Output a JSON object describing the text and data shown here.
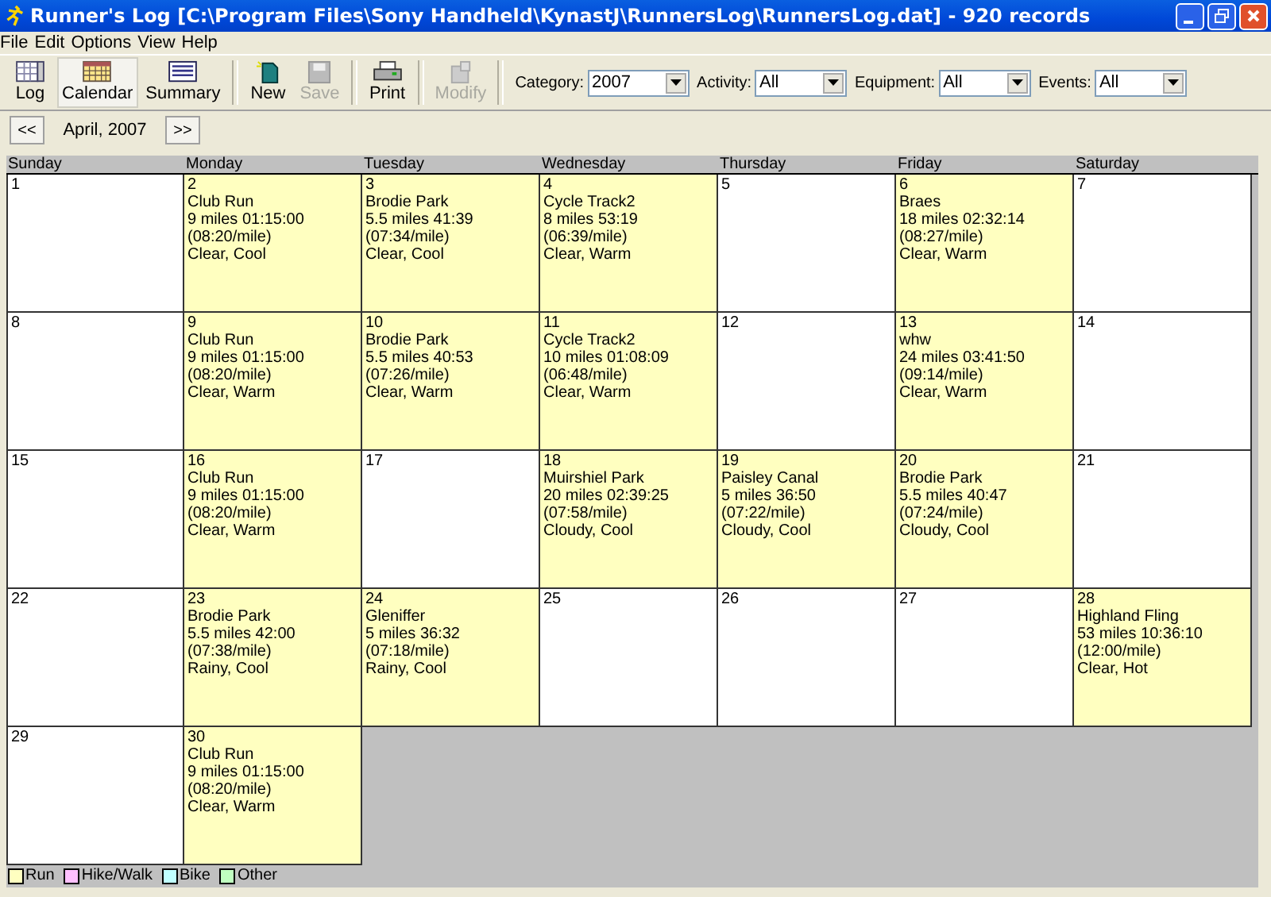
{
  "window": {
    "title": "Runner's Log [C:\\Program Files\\Sony Handheld\\KynastJ\\RunnersLog\\RunnersLog.dat] - 920 records"
  },
  "menu": [
    "File",
    "Edit",
    "Options",
    "View",
    "Help"
  ],
  "toolbar": [
    {
      "label": "Log",
      "kind": "log",
      "selected": false,
      "disabled": false,
      "separator": false
    },
    {
      "label": "Calendar",
      "kind": "calendar",
      "selected": true,
      "disabled": false,
      "separator": false
    },
    {
      "label": "Summary",
      "kind": "summary",
      "selected": false,
      "disabled": false,
      "separator": false
    },
    {
      "label": "New",
      "kind": "new",
      "selected": false,
      "disabled": false,
      "separator": true
    },
    {
      "label": "Save",
      "kind": "save",
      "selected": false,
      "disabled": true,
      "separator": false
    },
    {
      "label": "Print",
      "kind": "print",
      "selected": false,
      "disabled": false,
      "separator": true
    },
    {
      "label": "Modify",
      "kind": "modify",
      "selected": false,
      "disabled": true,
      "separator": true
    }
  ],
  "filters": [
    {
      "label": "Category:",
      "value": "2007"
    },
    {
      "label": "Activity:",
      "value": "All"
    },
    {
      "label": "Equipment:",
      "value": "All"
    },
    {
      "label": "Events:",
      "value": "All"
    }
  ],
  "nav": {
    "prev": "<<",
    "month": "April, 2007",
    "next": ">>"
  },
  "weekdays": [
    "Sunday",
    "Monday",
    "Tuesday",
    "Wednesday",
    "Thursday",
    "Friday",
    "Saturday"
  ],
  "weeks": [
    [
      {
        "day": "1"
      },
      {
        "day": "2",
        "kind": "run",
        "lines": [
          "Club Run",
          "9 miles 01:15:00",
          "(08:20/mile)",
          "Clear, Cool"
        ]
      },
      {
        "day": "3",
        "kind": "run",
        "lines": [
          "Brodie Park",
          "5.5 miles 41:39",
          "(07:34/mile)",
          "Clear, Cool"
        ]
      },
      {
        "day": "4",
        "kind": "run",
        "lines": [
          "Cycle Track2",
          "8 miles 53:19",
          "(06:39/mile)",
          "Clear, Warm"
        ]
      },
      {
        "day": "5"
      },
      {
        "day": "6",
        "kind": "run",
        "lines": [
          "Braes",
          "18 miles 02:32:14",
          "(08:27/mile)",
          "Clear, Warm"
        ]
      },
      {
        "day": "7"
      }
    ],
    [
      {
        "day": "8"
      },
      {
        "day": "9",
        "kind": "run",
        "lines": [
          "Club Run",
          "9 miles 01:15:00",
          "(08:20/mile)",
          "Clear, Warm"
        ]
      },
      {
        "day": "10",
        "kind": "run",
        "lines": [
          "Brodie Park",
          "5.5 miles 40:53",
          "(07:26/mile)",
          "Clear, Warm"
        ]
      },
      {
        "day": "11",
        "kind": "run",
        "lines": [
          "Cycle Track2",
          "10 miles 01:08:09",
          "(06:48/mile)",
          "Clear, Warm"
        ]
      },
      {
        "day": "12"
      },
      {
        "day": "13",
        "kind": "run",
        "lines": [
          "whw",
          "24 miles 03:41:50",
          "(09:14/mile)",
          "Clear, Warm"
        ]
      },
      {
        "day": "14"
      }
    ],
    [
      {
        "day": "15"
      },
      {
        "day": "16",
        "kind": "run",
        "lines": [
          "Club Run",
          "9 miles 01:15:00",
          "(08:20/mile)",
          "Clear, Warm"
        ]
      },
      {
        "day": "17"
      },
      {
        "day": "18",
        "kind": "run",
        "lines": [
          "Muirshiel Park",
          "20 miles 02:39:25",
          "(07:58/mile)",
          "Cloudy, Cool"
        ]
      },
      {
        "day": "19",
        "kind": "run",
        "lines": [
          "Paisley Canal",
          "5 miles 36:50",
          "(07:22/mile)",
          "Cloudy, Cool"
        ]
      },
      {
        "day": "20",
        "kind": "run",
        "lines": [
          "Brodie Park",
          "5.5 miles 40:47",
          "(07:24/mile)",
          "Cloudy, Cool"
        ]
      },
      {
        "day": "21"
      }
    ],
    [
      {
        "day": "22"
      },
      {
        "day": "23",
        "kind": "run",
        "lines": [
          "Brodie Park",
          "5.5 miles 42:00",
          "(07:38/mile)",
          "Rainy, Cool"
        ]
      },
      {
        "day": "24",
        "kind": "run",
        "lines": [
          "Gleniffer",
          "5 miles 36:32",
          "(07:18/mile)",
          "Rainy, Cool"
        ]
      },
      {
        "day": "25"
      },
      {
        "day": "26"
      },
      {
        "day": "27"
      },
      {
        "day": "28",
        "kind": "run",
        "lines": [
          "Highland Fling",
          "53 miles 10:36:10",
          "(12:00/mile)",
          "Clear, Hot"
        ]
      }
    ],
    [
      {
        "day": "29"
      },
      {
        "day": "30",
        "kind": "run",
        "lines": [
          "Club Run",
          "9 miles 01:15:00",
          "(08:20/mile)",
          "Clear, Warm"
        ]
      }
    ]
  ],
  "legend": [
    {
      "label": "Run",
      "kind": "run",
      "color": "#ffffc0"
    },
    {
      "label": "Hike/Walk",
      "kind": "hike",
      "color": "#ffc0ff"
    },
    {
      "label": "Bike",
      "kind": "bike",
      "color": "#c0ffff"
    },
    {
      "label": "Other",
      "kind": "other",
      "color": "#c0ffc0"
    }
  ]
}
